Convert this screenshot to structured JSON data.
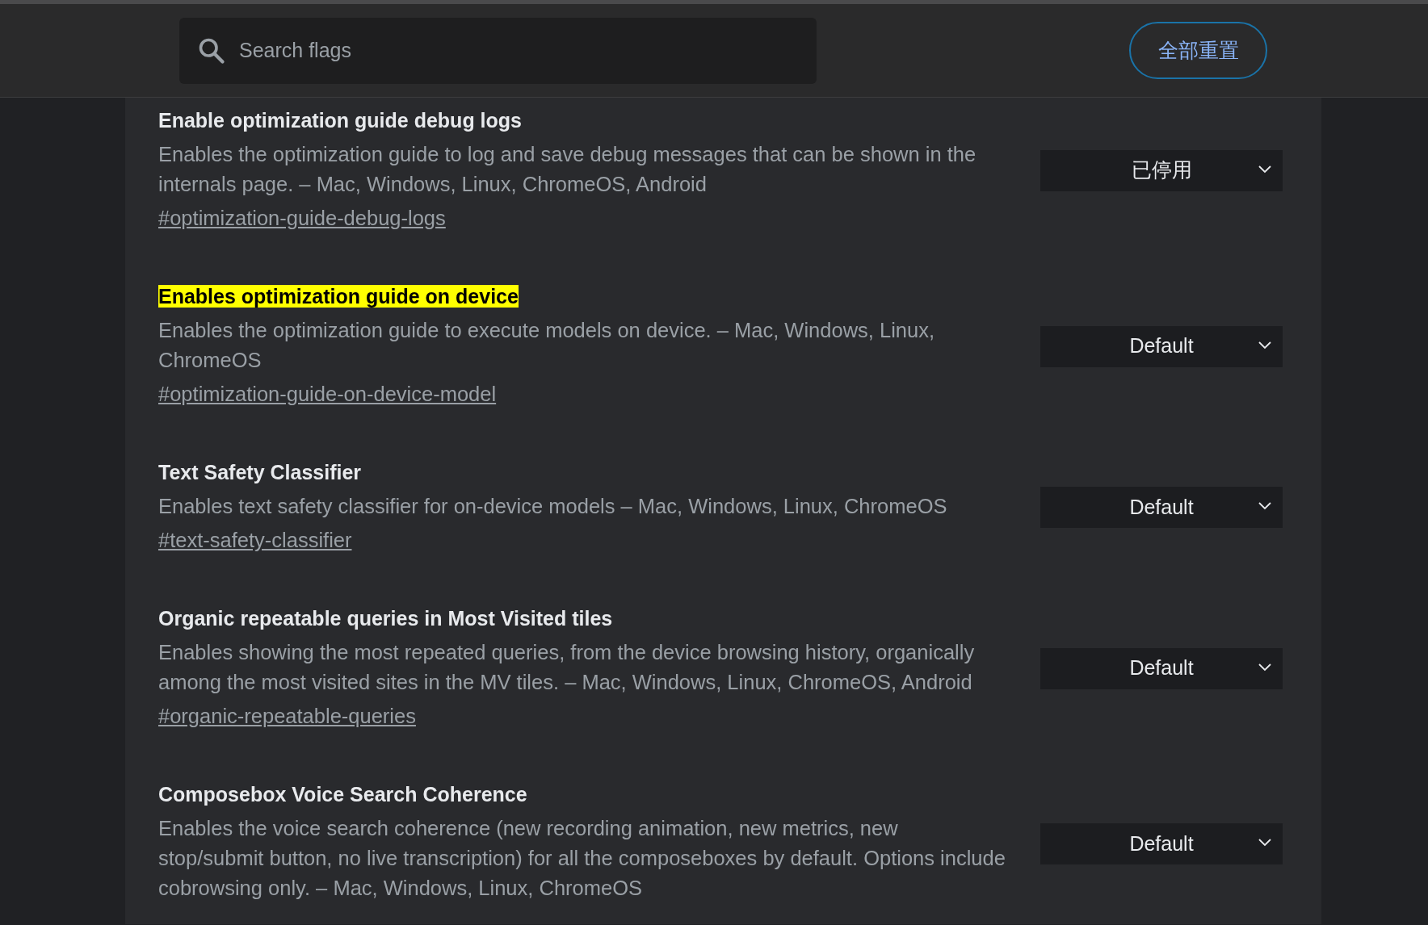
{
  "search": {
    "placeholder": "Search flags"
  },
  "reset_button": "全部重置",
  "flags": [
    {
      "title": "Enable optimization guide debug logs",
      "highlighted": false,
      "description": "Enables the optimization guide to log and save debug messages that can be shown in the internals page. – Mac, Windows, Linux, ChromeOS, Android",
      "link": "#optimization-guide-debug-logs",
      "value": "已停用"
    },
    {
      "title": "Enables optimization guide on device",
      "highlighted": true,
      "description": "Enables the optimization guide to execute models on device. – Mac, Windows, Linux, ChromeOS",
      "link": "#optimization-guide-on-device-model",
      "value": "Default"
    },
    {
      "title": "Text Safety Classifier",
      "highlighted": false,
      "description": "Enables text safety classifier for on-device models – Mac, Windows, Linux, ChromeOS",
      "link": "#text-safety-classifier",
      "value": "Default"
    },
    {
      "title": "Organic repeatable queries in Most Visited tiles",
      "highlighted": false,
      "description": "Enables showing the most repeated queries, from the device browsing history, organically among the most visited sites in the MV tiles. – Mac, Windows, Linux, ChromeOS, Android",
      "link": "#organic-repeatable-queries",
      "value": "Default"
    },
    {
      "title": "Composebox Voice Search Coherence",
      "highlighted": false,
      "description": "Enables the voice search coherence (new recording animation, new metrics, new stop/submit button, no live transcription) for all the composeboxes by default. Options include cobrowsing only. – Mac, Windows, Linux, ChromeOS",
      "value": "Default"
    }
  ]
}
